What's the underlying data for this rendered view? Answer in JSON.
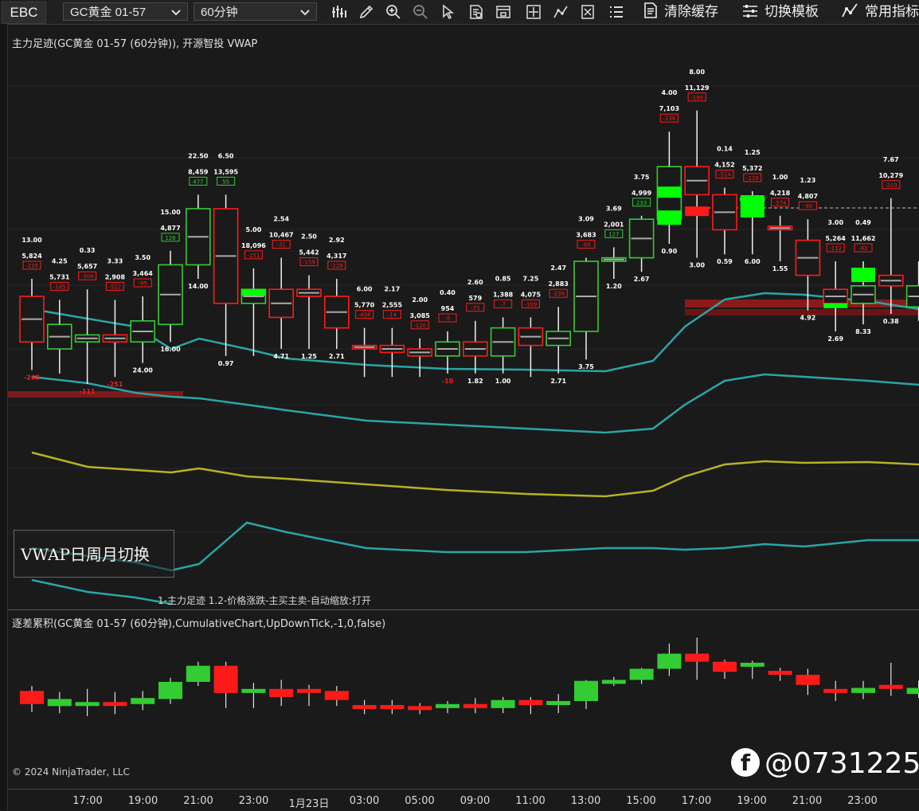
{
  "toolbar": {
    "broker": "EBC",
    "instrument": "GC黄金 01-57",
    "timeframe": "60分钟",
    "clear_cache": "清除缓存",
    "switch_template": "切换模板",
    "common_indicators": "常用指标"
  },
  "price_panel": {
    "title": "主力足迹(GC黄金 01-57 (60分钟)), 开源智投 VWAP",
    "vwap_button": "VWAP日周月切换",
    "status_line": "1-主力足迹 1.2-价格涨跌-主买主卖-自动缩放:打开"
  },
  "indicator_panel": {
    "title": "逐差累积(GC黄金 01-57 (60分钟),CumulativeChart,UpDownTick,-1,0,false)"
  },
  "copyright": "© 2024 NinjaTrader, LLC",
  "watermark": "@0731225",
  "xaxis": [
    "17:00",
    "19:00",
    "21:00",
    "23:00",
    "1月23日",
    "03:00",
    "05:00",
    "09:00",
    "11:00",
    "13:00",
    "15:00",
    "17:00",
    "19:00",
    "21:00",
    "23:00"
  ],
  "colors": {
    "up": "#33cc33",
    "down": "#ff1a1a",
    "bright_up": "#00ff00",
    "vwap": "#b9b122",
    "band": "#2aa5a5"
  },
  "chart_data": [
    {
      "type": "candlestick",
      "title": "主力足迹(GC黄金 01-57 (60分钟)), 开源智投 VWAP",
      "x": [
        "16:00",
        "17:00",
        "18:00",
        "19:00",
        "20:00",
        "21:00",
        "22:00",
        "23:00",
        "00:00",
        "01:00",
        "02:00",
        "03:00",
        "04:00",
        "05:00",
        "06:00",
        "07:00",
        "08:00",
        "09:00",
        "10:00",
        "11:00",
        "12:00",
        "13:00",
        "14:00",
        "15:00",
        "16:00",
        "17:00",
        "18:00",
        "19:00",
        "20:00",
        "21:00",
        "22:00",
        "23:00",
        "00:00"
      ],
      "bars_rel": [
        {
          "o": 0.35,
          "c": 0.48,
          "h": 0.3,
          "l": 0.56,
          "dir": "down"
        },
        {
          "o": 0.5,
          "c": 0.43,
          "h": 0.36,
          "l": 0.57,
          "dir": "up"
        },
        {
          "o": 0.48,
          "c": 0.46,
          "h": 0.33,
          "l": 0.6,
          "dir": "up"
        },
        {
          "o": 0.46,
          "c": 0.48,
          "h": 0.36,
          "l": 0.58,
          "dir": "down"
        },
        {
          "o": 0.48,
          "c": 0.42,
          "h": 0.35,
          "l": 0.54,
          "dir": "up"
        },
        {
          "o": 0.43,
          "c": 0.26,
          "h": 0.22,
          "l": 0.48,
          "dir": "up"
        },
        {
          "o": 0.26,
          "c": 0.1,
          "h": 0.06,
          "l": 0.3,
          "dir": "up"
        },
        {
          "o": 0.1,
          "c": 0.37,
          "h": 0.06,
          "l": 0.52,
          "dir": "down"
        },
        {
          "o": 0.37,
          "c": 0.33,
          "h": 0.27,
          "l": 0.52,
          "dir": "up"
        },
        {
          "o": 0.33,
          "c": 0.41,
          "h": 0.24,
          "l": 0.5,
          "dir": "down"
        },
        {
          "o": 0.33,
          "c": 0.35,
          "h": 0.29,
          "l": 0.5,
          "dir": "down"
        },
        {
          "o": 0.35,
          "c": 0.44,
          "h": 0.3,
          "l": 0.5,
          "dir": "down"
        },
        {
          "o": 0.49,
          "c": 0.5,
          "h": 0.44,
          "l": 0.58,
          "dir": "down"
        },
        {
          "o": 0.49,
          "c": 0.51,
          "h": 0.44,
          "l": 0.58,
          "dir": "down"
        },
        {
          "o": 0.5,
          "c": 0.52,
          "h": 0.47,
          "l": 0.58,
          "dir": "down"
        },
        {
          "o": 0.52,
          "c": 0.48,
          "h": 0.45,
          "l": 0.57,
          "dir": "up"
        },
        {
          "o": 0.48,
          "c": 0.52,
          "h": 0.42,
          "l": 0.57,
          "dir": "down"
        },
        {
          "o": 0.52,
          "c": 0.44,
          "h": 0.41,
          "l": 0.57,
          "dir": "up"
        },
        {
          "o": 0.44,
          "c": 0.49,
          "h": 0.41,
          "l": 0.58,
          "dir": "down"
        },
        {
          "o": 0.49,
          "c": 0.45,
          "h": 0.38,
          "l": 0.57,
          "dir": "up"
        },
        {
          "o": 0.45,
          "c": 0.25,
          "h": 0.24,
          "l": 0.53,
          "dir": "up"
        },
        {
          "o": 0.25,
          "c": 0.24,
          "h": 0.21,
          "l": 0.3,
          "dir": "up"
        },
        {
          "o": 0.24,
          "c": 0.13,
          "h": 0.12,
          "l": 0.28,
          "dir": "up"
        },
        {
          "o": 0.13,
          "c": -0.02,
          "h": -0.12,
          "l": 0.2,
          "dir": "up"
        },
        {
          "o": -0.02,
          "c": 0.06,
          "h": -0.18,
          "l": 0.24,
          "dir": "down"
        },
        {
          "o": 0.06,
          "c": 0.16,
          "h": 0.04,
          "l": 0.23,
          "dir": "down"
        },
        {
          "o": 0.07,
          "c": 0.07,
          "h": 0.05,
          "l": 0.23,
          "dir": "up"
        },
        {
          "o": 0.15,
          "c": 0.16,
          "h": 0.12,
          "l": 0.25,
          "dir": "down"
        },
        {
          "o": 0.19,
          "c": 0.29,
          "h": 0.13,
          "l": 0.39,
          "dir": "down"
        },
        {
          "o": 0.33,
          "c": 0.37,
          "h": 0.25,
          "l": 0.45,
          "dir": "down"
        },
        {
          "o": 0.37,
          "c": 0.32,
          "h": 0.25,
          "l": 0.43,
          "dir": "up"
        },
        {
          "o": 0.32,
          "c": 0.29,
          "h": 0.07,
          "l": 0.4,
          "dir": "down"
        },
        {
          "o": 0.38,
          "c": 0.32,
          "h": 0.25,
          "l": 0.42,
          "dir": "up"
        }
      ]
    },
    {
      "type": "candlestick",
      "title": "逐差累积(GC黄金 01-57 (60分钟),CumulativeChart,UpDownTick,-1,0,false)"
    }
  ],
  "bar_labels": [
    {
      "top": "13.00",
      "vol": "5,824",
      "delta": "-235",
      "foot": "-265"
    },
    {
      "top": "4.25",
      "vol": "5,731",
      "delta": "-185"
    },
    {
      "top": "0.33",
      "vol": "5,657",
      "delta": "-304",
      "foot": "-111"
    },
    {
      "top": "3.33",
      "vol": "2,908",
      "delta": "-522",
      "foot": "-251"
    },
    {
      "top": "3.50",
      "vol": "3,464",
      "delta": "-95",
      "foot": "24.00"
    },
    {
      "top": "15.00",
      "vol": "4,877",
      "delta": "126",
      "foot": "16.00"
    },
    {
      "top": "22.50",
      "vol": "8,459",
      "delta": "477",
      "foot": "14.00"
    },
    {
      "top": "6.50",
      "vol": "13,595",
      "delta": "55",
      "foot": "0.97"
    },
    {
      "top": "5.00",
      "vol": "18,096",
      "delta": "-151"
    },
    {
      "top": "2.54",
      "vol": "10,467",
      "delta": "-31",
      "foot": "4.71"
    },
    {
      "top": "2.50",
      "vol": "5,442",
      "delta": "-159",
      "foot": "1.25"
    },
    {
      "top": "2.92",
      "vol": "4,317",
      "delta": "-228",
      "foot": "2.71"
    },
    {
      "top": "6.00",
      "vol": "5,770",
      "delta": "-406"
    },
    {
      "top": "2.17",
      "vol": "2,555",
      "delta": "-14"
    },
    {
      "top": "2.00",
      "vol": "3,085",
      "delta": "-120"
    },
    {
      "top": "0.40",
      "vol": "954",
      "delta": "-5",
      "foot": "-10"
    },
    {
      "top": "2.60",
      "vol": "579",
      "delta": "-73",
      "foot": "1.82"
    },
    {
      "top": "0.85",
      "vol": "1,388",
      "delta": "-7",
      "foot": "1.00"
    },
    {
      "top": "7.25",
      "vol": "4,075",
      "delta": "-109"
    },
    {
      "top": "2.47",
      "vol": "2,883",
      "delta": "-239",
      "foot": "2.71"
    },
    {
      "top": "3.09",
      "vol": "3,683",
      "delta": "-80",
      "foot": "3.75"
    },
    {
      "top": "3.69",
      "vol": "2,001",
      "delta": "127",
      "foot": "1.20"
    },
    {
      "top": "3.75",
      "vol": "4,999",
      "delta": "233",
      "foot": "2.67"
    },
    {
      "top": "4.00",
      "vol": "7,103",
      "delta": "-138",
      "foot": "0.90"
    },
    {
      "top": "8.00",
      "vol": "11,129",
      "delta": "-199",
      "foot": "3.00"
    },
    {
      "top": "0.14",
      "vol": "4,152",
      "delta": "-514",
      "foot": "0.59"
    },
    {
      "top": "1.25",
      "vol": "5,372",
      "delta": "-239",
      "foot": "6.00"
    },
    {
      "top": "1.00",
      "vol": "4,218",
      "delta": "-574",
      "foot": "1.55"
    },
    {
      "top": "1.23",
      "vol": "4,807",
      "delta": "-90",
      "foot": "4.92"
    },
    {
      "top": "3.00",
      "vol": "5,264",
      "delta": "-112",
      "foot": "2.69"
    },
    {
      "top": "0.49",
      "vol": "11,662",
      "delta": "-82",
      "foot": "8.33"
    },
    {
      "top": "7.67",
      "vol": "10,279",
      "delta": "-203",
      "foot": "0.38"
    }
  ]
}
